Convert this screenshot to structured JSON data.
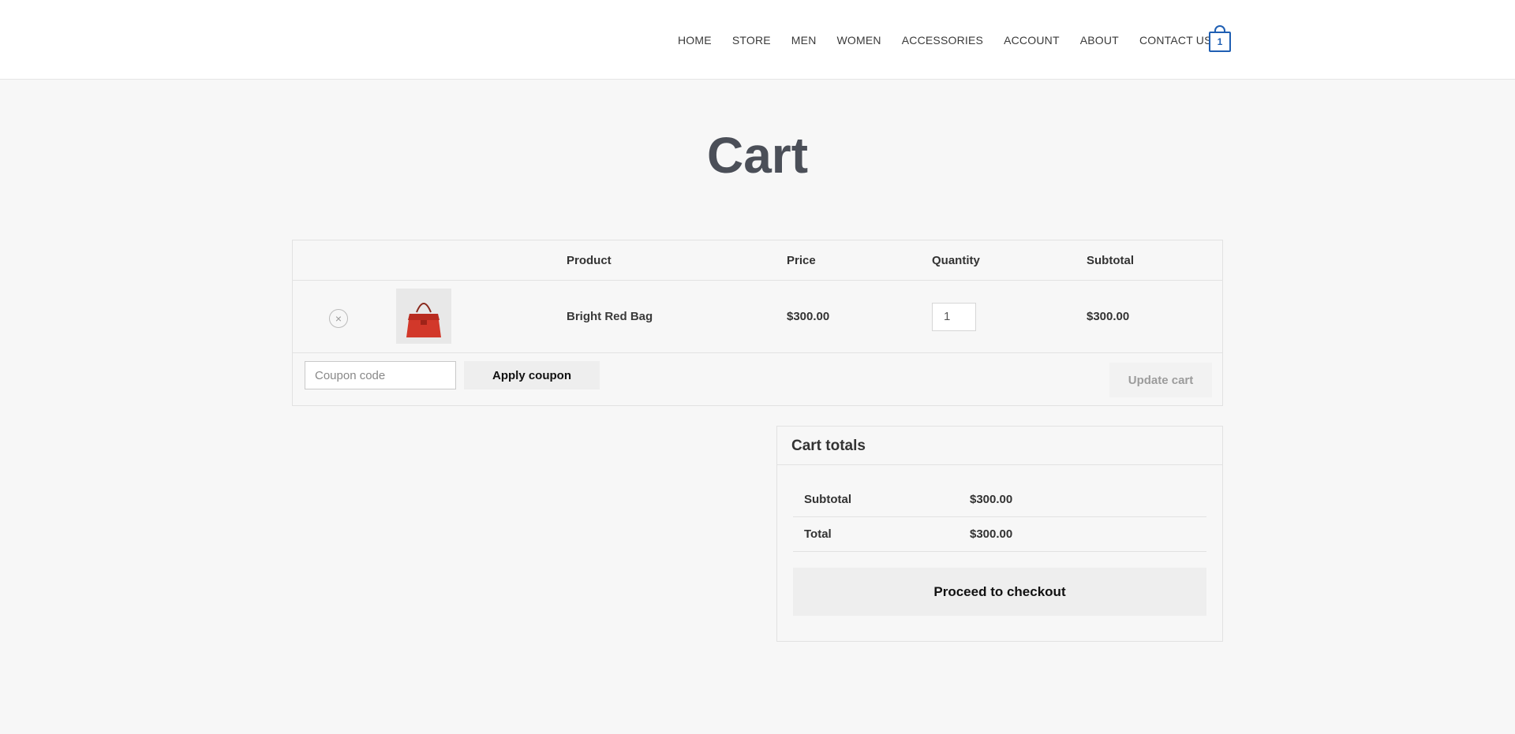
{
  "nav": {
    "items": [
      {
        "label": "HOME"
      },
      {
        "label": "STORE"
      },
      {
        "label": "MEN"
      },
      {
        "label": "WOMEN"
      },
      {
        "label": "ACCESSORIES"
      },
      {
        "label": "ACCOUNT"
      },
      {
        "label": "ABOUT"
      },
      {
        "label": "CONTACT US"
      }
    ],
    "cart_count": "1",
    "cart_icon": "shopping-bag-icon"
  },
  "page": {
    "title": "Cart"
  },
  "cart_table": {
    "headers": {
      "product": "Product",
      "price": "Price",
      "quantity": "Quantity",
      "subtotal": "Subtotal"
    },
    "items": [
      {
        "name": "Bright Red Bag",
        "price": "$300.00",
        "quantity": "1",
        "subtotal": "$300.00",
        "remove_icon": "close-circle-icon"
      }
    ],
    "coupon_placeholder": "Coupon code",
    "apply_coupon_label": "Apply coupon",
    "update_cart_label": "Update cart"
  },
  "totals": {
    "title": "Cart totals",
    "subtotal_label": "Subtotal",
    "subtotal_value": "$300.00",
    "total_label": "Total",
    "total_value": "$300.00",
    "checkout_label": "Proceed to checkout"
  },
  "colors": {
    "accent": "#1f5fb3",
    "background": "#f7f7f7",
    "title": "#4b4f58"
  }
}
